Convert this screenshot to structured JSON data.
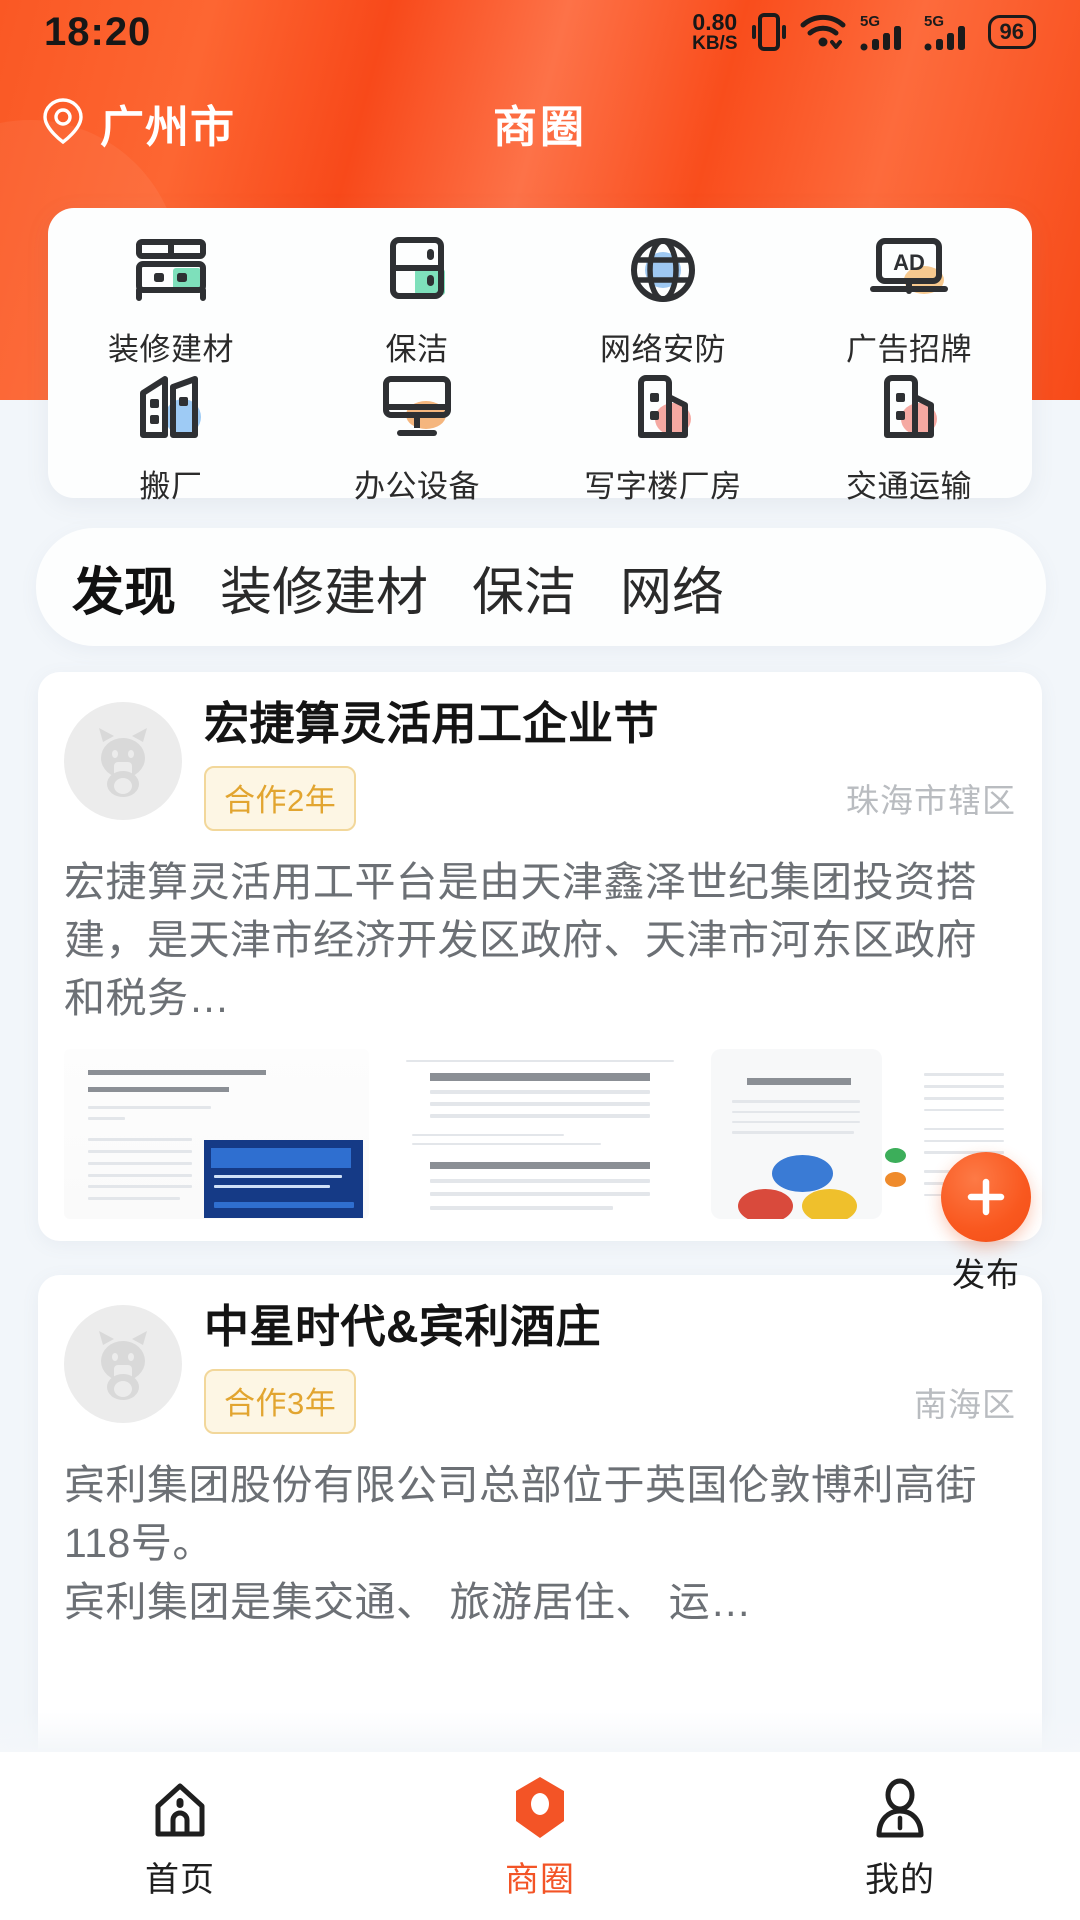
{
  "statusbar": {
    "time": "18:20",
    "net_speed_value": "0.80",
    "net_speed_unit": "KB/S",
    "battery": "96",
    "signal_1_label": "5G",
    "signal_2_label": "5G",
    "icons": [
      "vibrate-icon",
      "wifi-icon",
      "signal-icon",
      "signal-icon",
      "battery-icon"
    ]
  },
  "header": {
    "location": "广州市",
    "title": "商圈",
    "accent_color": "#f9551f"
  },
  "categories": [
    {
      "label": "装修建材",
      "icon": "building-material-icon",
      "accent": "#7ee0bb"
    },
    {
      "label": "保洁",
      "icon": "cabinet-icon",
      "accent": "#7ee0bb"
    },
    {
      "label": "网络安防",
      "icon": "globe-icon",
      "accent": "#9ec8f2"
    },
    {
      "label": "广告招牌",
      "icon": "ad-board-icon",
      "accent": "#f7c98f"
    },
    {
      "label": "搬厂",
      "icon": "factory-move-icon",
      "accent": "#9ecbf5"
    },
    {
      "label": "办公设备",
      "icon": "monitor-icon",
      "accent": "#f5b67e"
    },
    {
      "label": "写字楼厂房",
      "icon": "office-building-icon",
      "accent": "#f5a9a2"
    },
    {
      "label": "交通运输",
      "icon": "transport-building-icon",
      "accent": "#f5a9a2"
    }
  ],
  "tabs": [
    {
      "label": "发现",
      "active": true
    },
    {
      "label": "装修建材",
      "active": false
    },
    {
      "label": "保洁",
      "active": false
    },
    {
      "label": "网络",
      "active": false
    }
  ],
  "feed": [
    {
      "avatar": "cat-placeholder-avatar",
      "title": "宏捷算灵活用工企业节",
      "badge": "合作2年",
      "region": "珠海市辖区",
      "body": "宏捷算灵活用工平台是由天津鑫泽世纪集团投资搭建，是天津市经济开发区政府、天津市河东区政府和税务…",
      "thumb_count": 3
    },
    {
      "avatar": "cat-placeholder-avatar",
      "title": "中星时代&宾利酒庄",
      "badge": "合作3年",
      "region": "南海区",
      "body": "宾利集团股份有限公司总部位于英国伦敦博利高街118号。\n宾利集团是集交通、 旅游居住、 运…",
      "thumb_count": 3
    }
  ],
  "fab": {
    "icon": "plus-icon",
    "label": "发布",
    "color": "#f9581f"
  },
  "bottomnav": [
    {
      "label": "首页",
      "icon": "home-icon",
      "active": false
    },
    {
      "label": "商圈",
      "icon": "business-circle-icon",
      "active": true
    },
    {
      "label": "我的",
      "icon": "person-icon",
      "active": false
    }
  ]
}
